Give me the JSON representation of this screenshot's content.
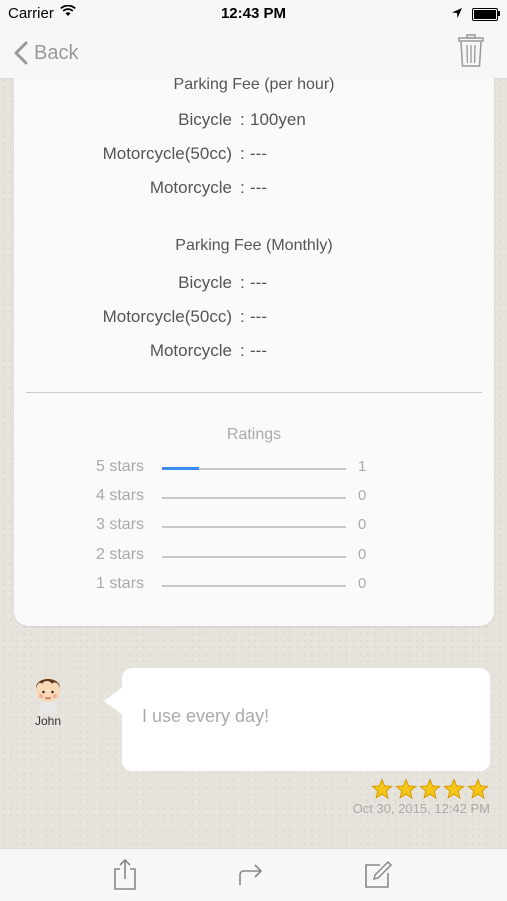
{
  "status_bar": {
    "carrier": "Carrier",
    "time": "12:43 PM"
  },
  "nav": {
    "back_label": "Back",
    "back_icon": "chevron-left-icon",
    "trash_icon": "trash-icon"
  },
  "parking_fee_hourly": {
    "title": "Parking Fee (per hour)",
    "rows": [
      {
        "label": "Bicycle",
        "value": "100yen"
      },
      {
        "label": "Motorcycle(50cc)",
        "value": "---"
      },
      {
        "label": "Motorcycle",
        "value": "---"
      }
    ]
  },
  "parking_fee_monthly": {
    "title": "Parking Fee (Monthly)",
    "rows": [
      {
        "label": "Bicycle",
        "value": "---"
      },
      {
        "label": "Motorcycle(50cc)",
        "value": "---"
      },
      {
        "label": "Motorcycle",
        "value": "---"
      }
    ]
  },
  "ratings": {
    "title": "Ratings",
    "rows": [
      {
        "label": "5 stars",
        "count": "1",
        "fraction": 0.2
      },
      {
        "label": "4 stars",
        "count": "0",
        "fraction": 0
      },
      {
        "label": "3 stars",
        "count": "0",
        "fraction": 0
      },
      {
        "label": "2 stars",
        "count": "0",
        "fraction": 0
      },
      {
        "label": "1 stars",
        "count": "0",
        "fraction": 0
      }
    ],
    "bar_color": "#3d8df0"
  },
  "review": {
    "user_name": "John",
    "text": "I use every day!",
    "stars": 5,
    "date": "Oct 30, 2015, 12:42 PM"
  },
  "toolbar": {
    "icons": [
      "share-icon",
      "forward-icon",
      "compose-icon"
    ]
  },
  "colors": {
    "accent": "#3d8df0",
    "star": "#f5c518"
  }
}
